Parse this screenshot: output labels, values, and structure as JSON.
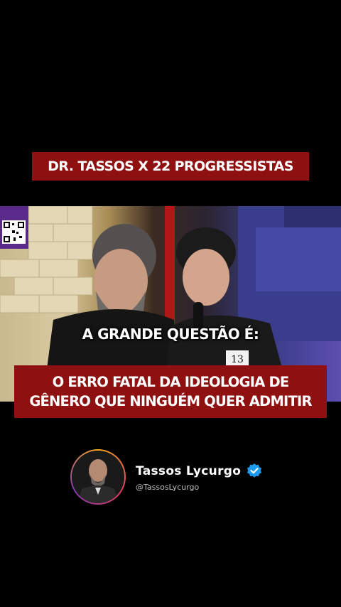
{
  "title_banner": "DR. TASSOS X 22 PROGRESSISTAS",
  "question": "A GRANDE QUESTÃO É:",
  "headline": {
    "line1": "O ERRO FATAL DA IDEOLOGIA DE",
    "line2": "GÊNERO QUE NINGUÉM QUER ADMITIR"
  },
  "video": {
    "participant_number": "13"
  },
  "profile": {
    "name": "Tassos Lycurgo",
    "handle": "@TassosLycurgo"
  },
  "colors": {
    "banner_red": "#8f1010",
    "verified_blue": "#1d9bf0"
  },
  "icons": [
    "qr-code-icon",
    "verified-badge-icon"
  ]
}
